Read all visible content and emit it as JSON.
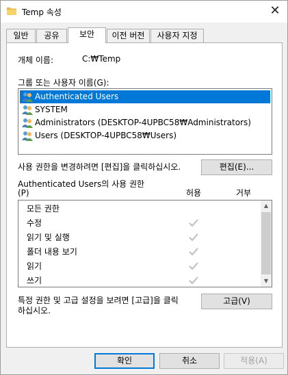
{
  "window": {
    "title": "Temp 속성",
    "close_glyph": "✕"
  },
  "tabs": [
    {
      "label": "일반"
    },
    {
      "label": "공유"
    },
    {
      "label": "보안"
    },
    {
      "label": "이전 버전"
    },
    {
      "label": "사용자 지정"
    }
  ],
  "security": {
    "object_name_label": "개체 이름:",
    "object_name_value": "C:₩Temp",
    "group_label": "그룹 또는 사용자 이름(G):",
    "users": [
      {
        "name": "Authenticated Users",
        "selected": true
      },
      {
        "name": "SYSTEM",
        "selected": false
      },
      {
        "name": "Administrators (DESKTOP-4UPBC58₩Administrators)",
        "selected": false
      },
      {
        "name": "Users (DESKTOP-4UPBC58₩Users)",
        "selected": false
      }
    ],
    "change_hint": "사용 권한을 변경하려면 [편집]을 클릭하십시오.",
    "edit_button": "편집(E)...",
    "perm_label_line1": "Authenticated Users의 사용 권한",
    "perm_label_line2": "(P)",
    "allow_header": "허용",
    "deny_header": "거부",
    "permissions": [
      {
        "name": "모든 권한",
        "allow": false
      },
      {
        "name": "수정",
        "allow": true
      },
      {
        "name": "읽기 및 실행",
        "allow": true
      },
      {
        "name": "폴더 내용 보기",
        "allow": true
      },
      {
        "name": "읽기",
        "allow": true
      },
      {
        "name": "쓰기",
        "allow": true
      }
    ],
    "advanced_hint_line1": "특정 권한 및 고급 설정을 보려면 [고급]을 클릭",
    "advanced_hint_line2": "하십시오.",
    "advanced_button": "고급(V)"
  },
  "footer": {
    "ok": "확인",
    "cancel": "취소",
    "apply": "적용(A)"
  },
  "colors": {
    "selection": "#0078d7",
    "check": "#bdbdbd"
  }
}
